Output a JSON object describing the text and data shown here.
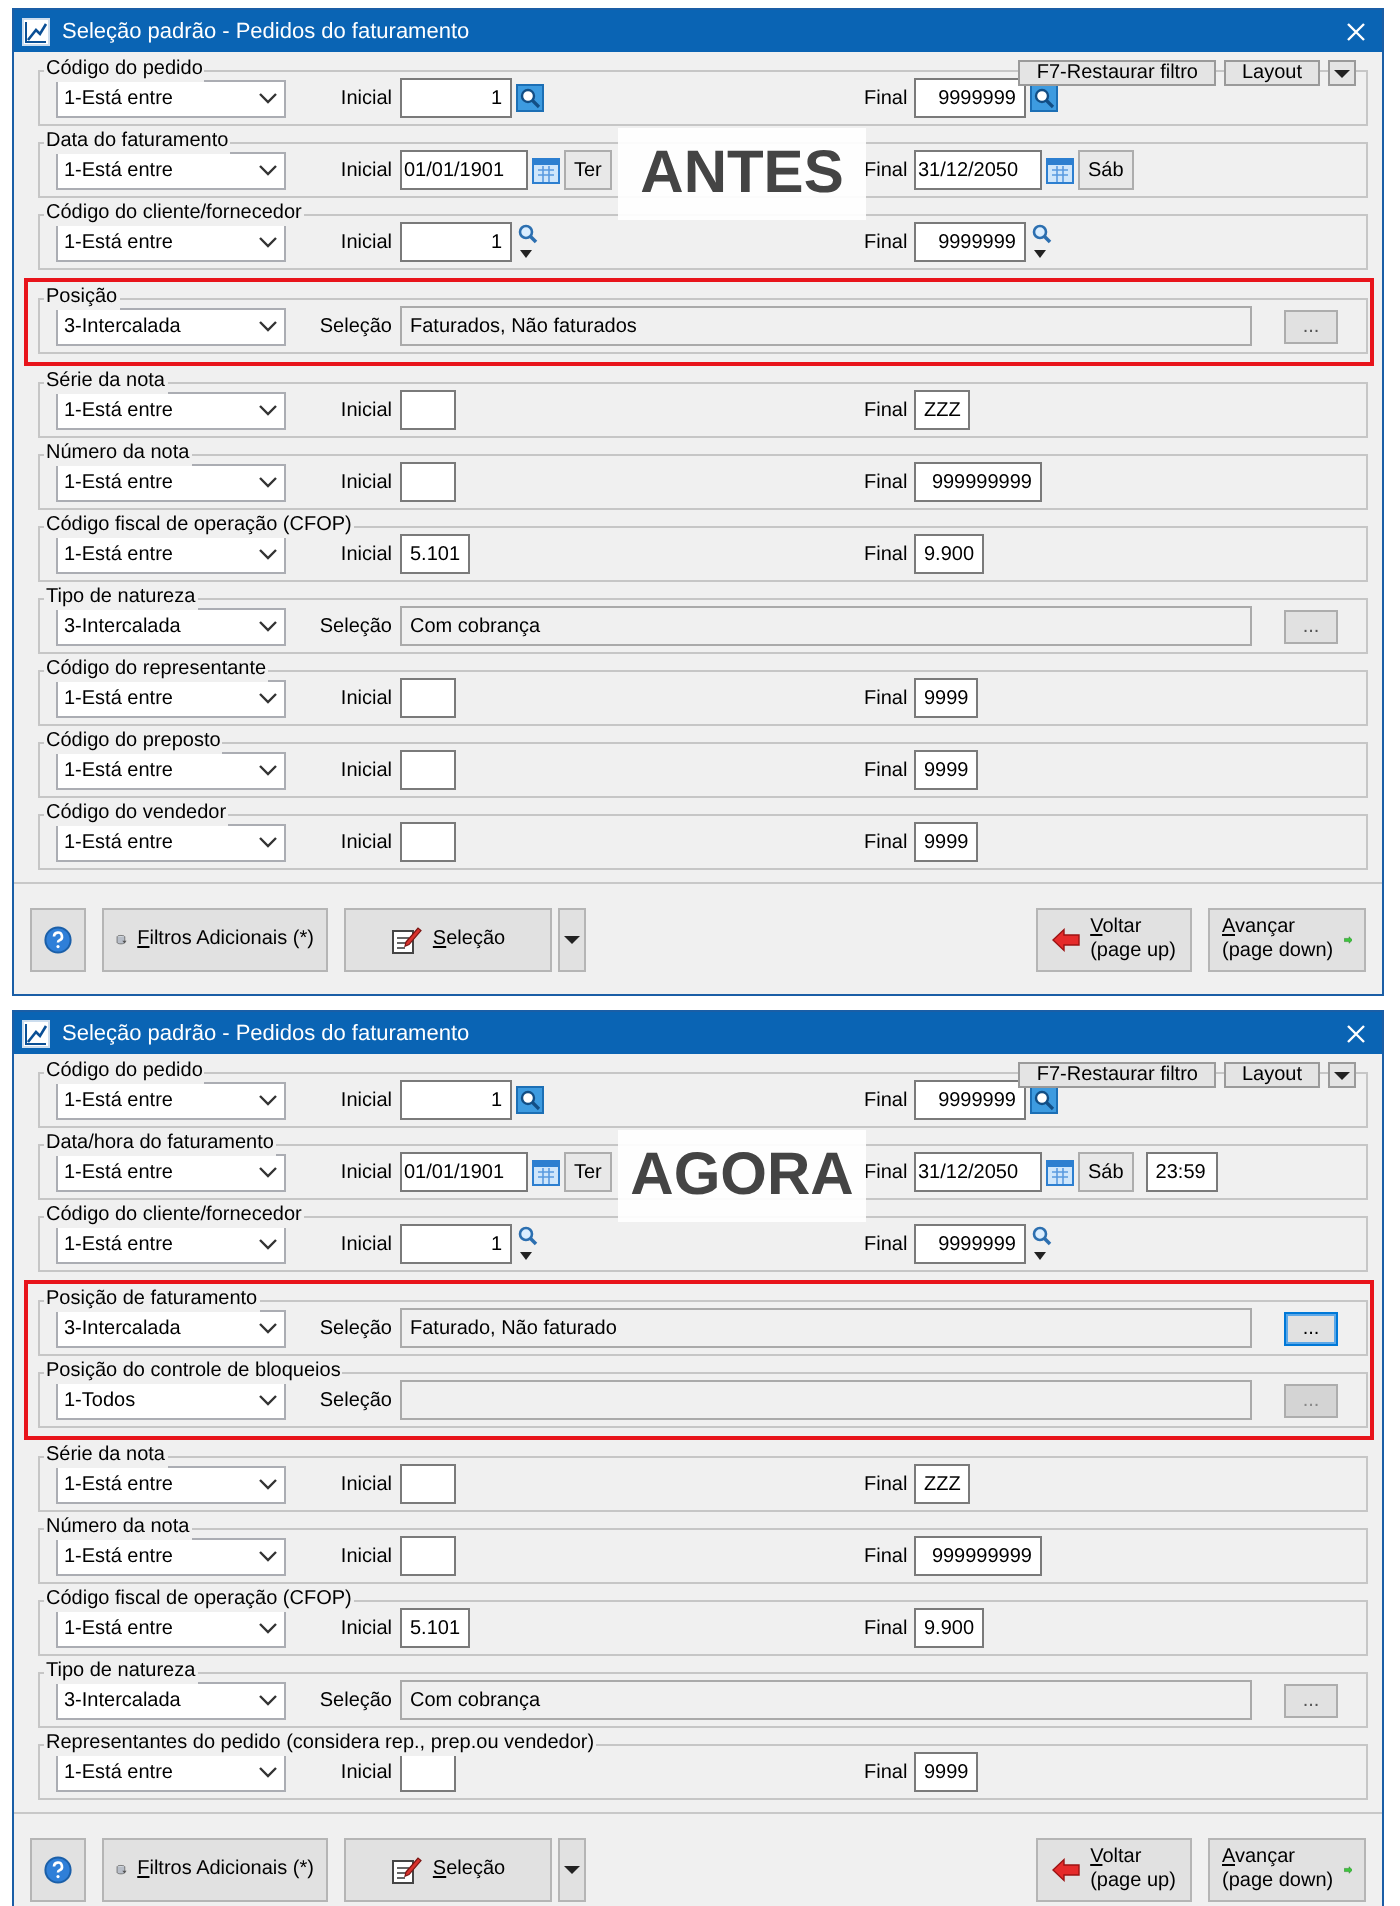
{
  "panels": [
    {
      "title": "Seleção padrão - Pedidos do faturamento",
      "overlay_label": "ANTES",
      "toolbar": [
        "F7-Restaurar filtro",
        "Layout"
      ],
      "sections": [
        {
          "highlighted": false,
          "groups": [
            {
              "kind": "range",
              "label": "Código do pedido",
              "operator": "1-Está entre",
              "initial_label": "Inicial",
              "initial": "1",
              "final_label": "Final",
              "final": "9999999",
              "search_button": true
            },
            {
              "kind": "date",
              "label": "Data do faturamento",
              "operator": "1-Está entre",
              "initial_label": "Inicial",
              "initial": "01/01/1901",
              "initial_day": "Ter",
              "final_label": "Final",
              "final": "31/12/2050",
              "final_day": "Sáb"
            },
            {
              "kind": "range",
              "label": "Código do cliente/fornecedor",
              "operator": "1-Está entre",
              "initial_label": "Inicial",
              "initial": "1",
              "final_label": "Final",
              "final": "9999999",
              "search_menu": true
            }
          ]
        },
        {
          "highlighted": true,
          "groups": [
            {
              "kind": "selection",
              "label": "Posição",
              "operator": "3-Intercalada",
              "selection_label": "Seleção",
              "selection": "Faturados, Não faturados",
              "button": "...",
              "button_disabled": false,
              "button_focused": false
            }
          ]
        },
        {
          "highlighted": false,
          "groups": [
            {
              "kind": "range",
              "label": "Série da nota",
              "operator": "1-Está entre",
              "initial_label": "Inicial",
              "final_label": "Final",
              "final": "ZZZ"
            },
            {
              "kind": "range",
              "label": "Número da nota",
              "operator": "1-Está entre",
              "initial_label": "Inicial",
              "final_label": "Final",
              "final": "999999999"
            },
            {
              "kind": "range",
              "label": "Código fiscal de operação (CFOP)",
              "operator": "1-Está entre",
              "initial_label": "Inicial",
              "initial": "5.101",
              "final_label": "Final",
              "final": "9.900"
            },
            {
              "kind": "selection",
              "label": "Tipo de natureza",
              "operator": "3-Intercalada",
              "selection_label": "Seleção",
              "selection": "Com cobrança",
              "button": "...",
              "button_disabled": false,
              "button_focused": false
            },
            {
              "kind": "range",
              "label": "Código do representante",
              "operator": "1-Está entre",
              "initial_label": "Inicial",
              "final_label": "Final",
              "final": "9999"
            },
            {
              "kind": "range",
              "label": "Código do preposto",
              "operator": "1-Está entre",
              "initial_label": "Inicial",
              "final_label": "Final",
              "final": "9999"
            },
            {
              "kind": "range",
              "label": "Código do vendedor",
              "operator": "1-Está entre",
              "initial_label": "Inicial",
              "final_label": "Final",
              "final": "9999"
            }
          ]
        }
      ],
      "footer": [
        {
          "kind": "help"
        },
        {
          "kind": "filter",
          "label": "Filtros Adicionais (*)"
        },
        {
          "kind": "edit",
          "label": "Seleção"
        },
        {
          "kind": "menu"
        },
        {
          "kind": "back",
          "label": "Voltar",
          "hint": "(page up)"
        },
        {
          "kind": "next",
          "label": "Avançar",
          "hint": "(page down)"
        }
      ]
    },
    {
      "title": "Seleção padrão - Pedidos do faturamento",
      "overlay_label": "AGORA",
      "toolbar": [
        "F7-Restaurar filtro",
        "Layout"
      ],
      "sections": [
        {
          "highlighted": false,
          "groups": [
            {
              "kind": "range",
              "label": "Código do pedido",
              "operator": "1-Está entre",
              "initial_label": "Inicial",
              "initial": "1",
              "final_label": "Final",
              "final": "9999999",
              "search_button": true
            },
            {
              "kind": "date",
              "label": "Data/hora do faturamento",
              "operator": "1-Está entre",
              "initial_label": "Inicial",
              "initial": "01/01/1901",
              "initial_day": "Ter",
              "final_label": "Final",
              "final": "31/12/2050",
              "final_day": "Sáb",
              "final_time": "23:59"
            },
            {
              "kind": "range",
              "label": "Código do cliente/fornecedor",
              "operator": "1-Está entre",
              "initial_label": "Inicial",
              "initial": "1",
              "final_label": "Final",
              "final": "9999999",
              "search_menu": true
            }
          ]
        },
        {
          "highlighted": true,
          "groups": [
            {
              "kind": "selection",
              "label": "Posição de faturamento",
              "operator": "3-Intercalada",
              "selection_label": "Seleção",
              "selection": "Faturado, Não faturado",
              "button": "...",
              "button_disabled": false,
              "button_focused": true
            },
            {
              "kind": "selection",
              "label": "Posição do controle de bloqueios",
              "operator": "1-Todos",
              "selection_label": "Seleção",
              "button": "...",
              "button_disabled": true,
              "button_focused": false
            }
          ]
        },
        {
          "highlighted": false,
          "groups": [
            {
              "kind": "range",
              "label": "Série da nota",
              "operator": "1-Está entre",
              "initial_label": "Inicial",
              "final_label": "Final",
              "final": "ZZZ"
            },
            {
              "kind": "range",
              "label": "Número da nota",
              "operator": "1-Está entre",
              "initial_label": "Inicial",
              "final_label": "Final",
              "final": "999999999"
            },
            {
              "kind": "range",
              "label": "Código fiscal de operação (CFOP)",
              "operator": "1-Está entre",
              "initial_label": "Inicial",
              "initial": "5.101",
              "final_label": "Final",
              "final": "9.900"
            },
            {
              "kind": "selection",
              "label": "Tipo de natureza",
              "operator": "3-Intercalada",
              "selection_label": "Seleção",
              "selection": "Com cobrança",
              "button": "...",
              "button_disabled": false,
              "button_focused": false
            },
            {
              "kind": "range",
              "label": "Representantes do pedido (considera rep., prep.ou vendedor)",
              "operator": "1-Está entre",
              "initial_label": "Inicial",
              "final_label": "Final",
              "final": "9999"
            }
          ]
        }
      ],
      "footer": [
        {
          "kind": "help"
        },
        {
          "kind": "filter",
          "label": "Filtros Adicionais (*)"
        },
        {
          "kind": "edit",
          "label": "Seleção"
        },
        {
          "kind": "menu"
        },
        {
          "kind": "back",
          "label": "Voltar",
          "hint": "(page up)"
        },
        {
          "kind": "next",
          "label": "Avançar",
          "hint": "(page down)"
        }
      ]
    }
  ]
}
